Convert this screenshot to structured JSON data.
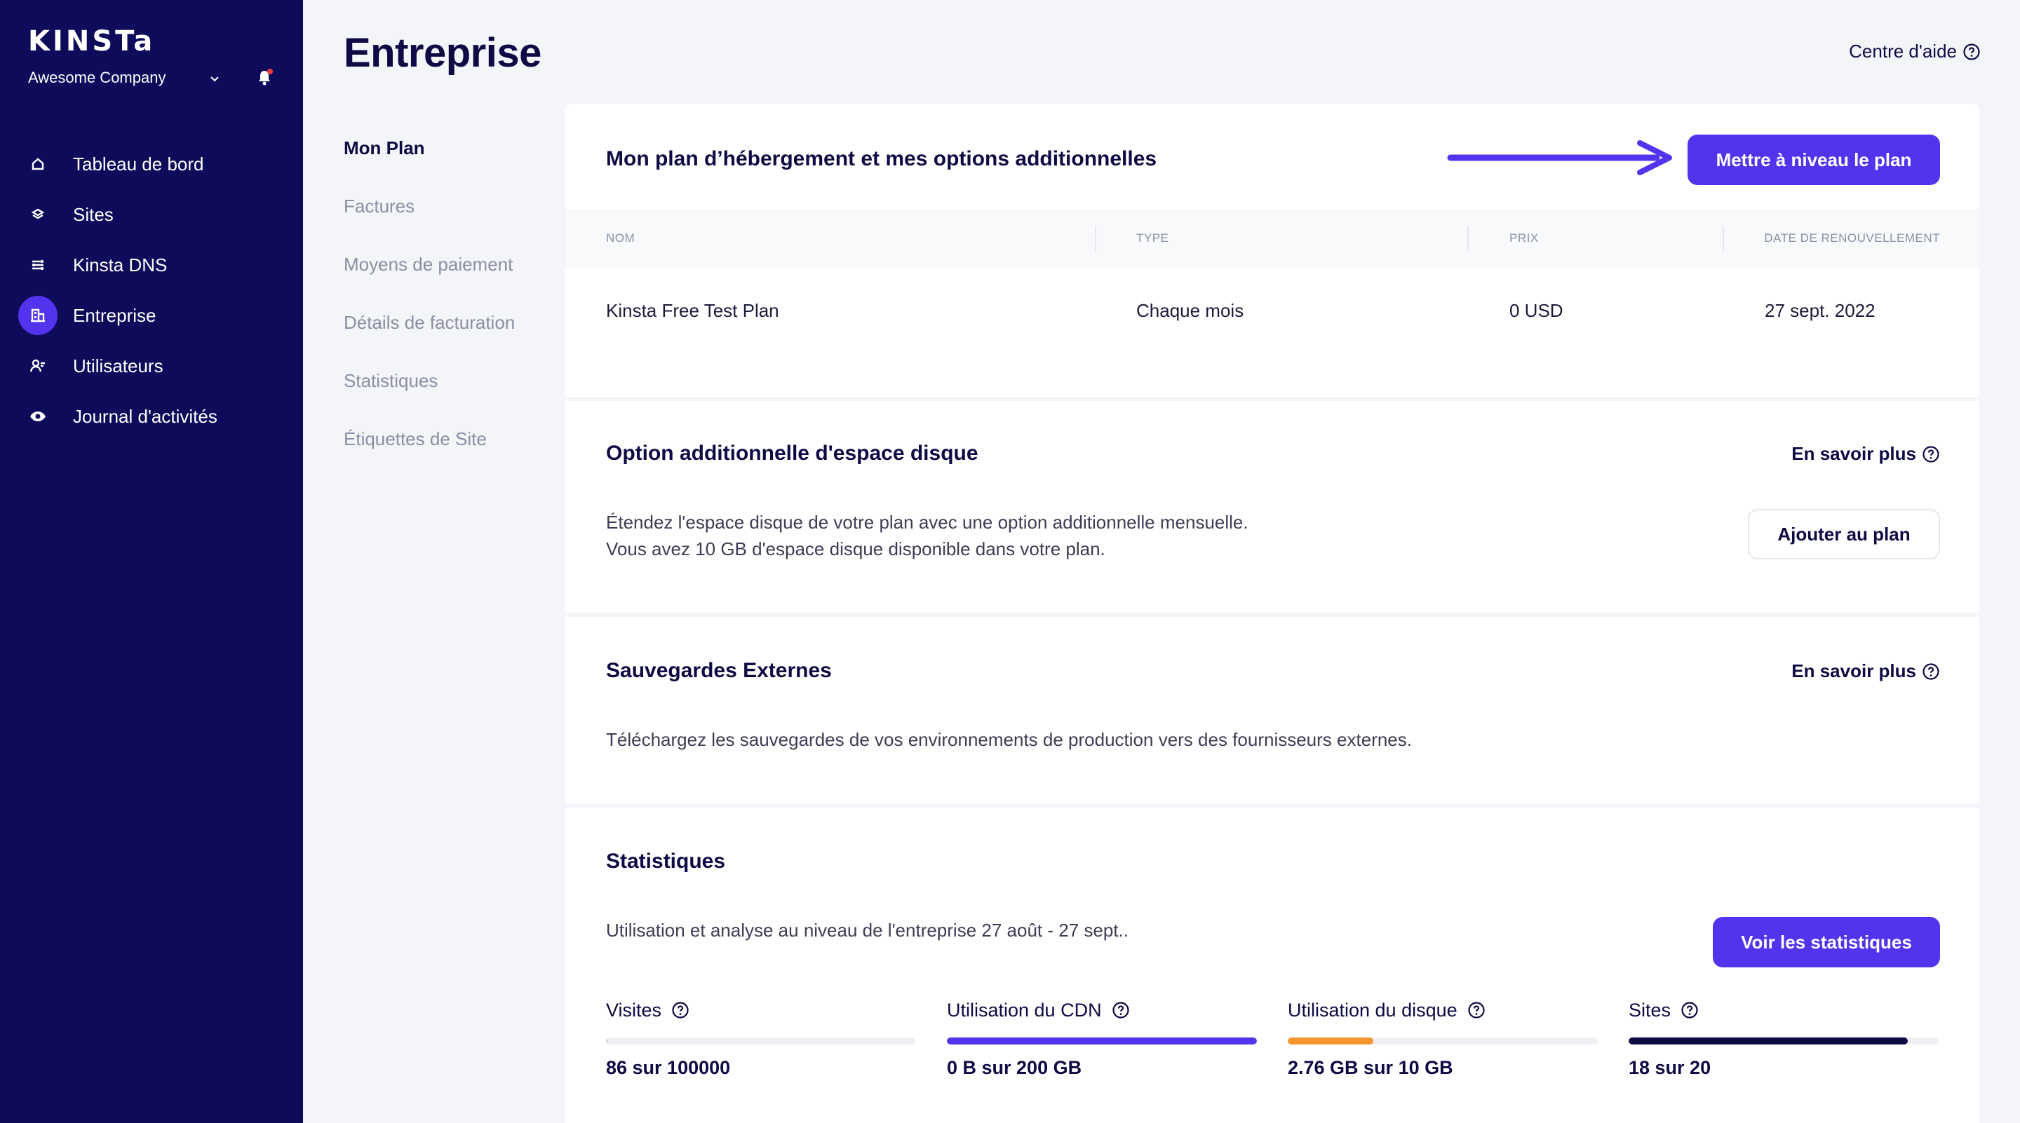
{
  "brand": {
    "logo_text": "KINSTa",
    "company": "Awesome Company"
  },
  "sidebar": {
    "items": [
      {
        "label": "Tableau de bord",
        "icon": "home-icon"
      },
      {
        "label": "Sites",
        "icon": "layers-icon"
      },
      {
        "label": "Kinsta DNS",
        "icon": "dns-icon"
      },
      {
        "label": "Entreprise",
        "icon": "building-icon",
        "active": true
      },
      {
        "label": "Utilisateurs",
        "icon": "users-icon"
      },
      {
        "label": "Journal d'activités",
        "icon": "eye-icon"
      }
    ]
  },
  "header": {
    "title": "Entreprise",
    "help": "Centre d'aide"
  },
  "subnav": {
    "items": [
      "Mon Plan",
      "Factures",
      "Moyens de paiement",
      "Détails de facturation",
      "Statistiques",
      "Étiquettes de Site"
    ],
    "active_index": 0
  },
  "plan": {
    "title": "Mon plan d’hébergement et mes options additionnelles",
    "upgrade_button": "Mettre à niveau le plan",
    "columns": [
      "NOM",
      "TYPE",
      "PRIX",
      "DATE DE RENOUVELLEMENT"
    ],
    "row": {
      "name": "Kinsta Free Test Plan",
      "type": "Chaque mois",
      "price": "0 USD",
      "renewal": "27 sept. 2022"
    }
  },
  "disk": {
    "title": "Option additionnelle d'espace disque",
    "learn_more": "En savoir plus",
    "desc_line1": "Étendez l'espace disque de votre plan avec une option additionnelle mensuelle.",
    "desc_line2": "Vous avez 10 GB d'espace disque disponible dans votre plan.",
    "button": "Ajouter au plan"
  },
  "backups": {
    "title": "Sauvegardes Externes",
    "learn_more": "En savoir plus",
    "desc": "Téléchargez les sauvegardes de vos environnements de production vers des fournisseurs externes."
  },
  "stats": {
    "title": "Statistiques",
    "desc": "Utilisation et analyse au niveau de l'entreprise 27 août - 27 sept..",
    "button": "Voir les statistiques",
    "items": [
      {
        "label": "Visites",
        "value": "86 sur 100000",
        "fraction": 0.00086,
        "color": "#c9cad6"
      },
      {
        "label": "Utilisation du CDN",
        "value": "0 B sur 200 GB",
        "fraction": 1.0,
        "color": "#5333ed"
      },
      {
        "label": "Utilisation du disque",
        "value": "2.76 GB sur 10 GB",
        "fraction": 0.276,
        "color": "#f5962f"
      },
      {
        "label": "Sites",
        "value": "18 sur 20",
        "fraction": 0.9,
        "color": "#0e0b44"
      }
    ]
  },
  "colors": {
    "sidebar_bg": "#0e0b5a",
    "accent": "#5333ed",
    "disk_bar": "#f5962f",
    "sites_bar": "#0e0b44"
  }
}
